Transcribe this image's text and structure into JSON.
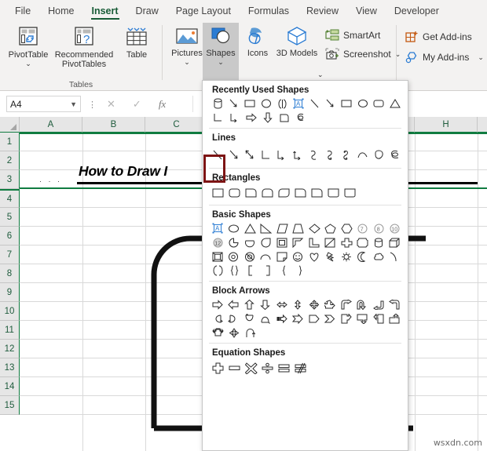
{
  "ribbon": {
    "tabs": [
      {
        "label": "File",
        "active": false
      },
      {
        "label": "Home",
        "active": false
      },
      {
        "label": "Insert",
        "active": true
      },
      {
        "label": "Draw",
        "active": false
      },
      {
        "label": "Page Layout",
        "active": false
      },
      {
        "label": "Formulas",
        "active": false
      },
      {
        "label": "Review",
        "active": false
      },
      {
        "label": "View",
        "active": false
      },
      {
        "label": "Developer",
        "active": false
      }
    ],
    "groups": [
      {
        "name": "tables",
        "label": "Tables"
      },
      {
        "name": "illustrations",
        "label": ""
      },
      {
        "name": "addins",
        "label": ""
      }
    ],
    "buttons": {
      "pivot_table": "PivotTable",
      "recommended_pivot_tables": "Recommended PivotTables",
      "table": "Table",
      "pictures": "Pictures",
      "shapes": "Shapes",
      "icons": "Icons",
      "three_d_models": "3D Models",
      "smart_art": "SmartArt",
      "screenshot": "Screenshot",
      "get_addins": "Get Add-ins",
      "my_addins": "My Add-ins"
    }
  },
  "formula_bar": {
    "name_box_value": "A4",
    "cancel_icon": "cancel-icon",
    "enter_icon": "check-icon",
    "function_icon": "fx",
    "formula_value": ""
  },
  "grid": {
    "columns": [
      "A",
      "B",
      "C",
      "H"
    ],
    "rows": [
      "1",
      "2",
      "3",
      "4",
      "5",
      "6",
      "7",
      "8",
      "9",
      "10",
      "11",
      "12",
      "13",
      "14",
      "15"
    ],
    "active_cell": "A4",
    "title_cell_text": "How to Draw I",
    "watermark": "wsxdn.com"
  },
  "shapes_menu": {
    "sections": [
      {
        "title": "Recently Used Shapes",
        "rows": [
          [
            "can-shape",
            "line-arrow-shape",
            "rectangle-shape",
            "oval-shape",
            "double-bracket-shape",
            "text-box-shape",
            "line-shape",
            "line-arrow2-shape",
            "rectangle2-shape",
            "oval2-shape",
            "rounded-rect-shape",
            "triangle-shape"
          ],
          [
            "elbow-connector-shape",
            "elbow-arrow-connector-shape",
            "right-arrow-shape",
            "down-arrow-shape",
            "flowchart-shape",
            "scribble-shape"
          ]
        ]
      },
      {
        "title": "Lines",
        "rows": [
          [
            "line-shape",
            "line-arrow-shape",
            "line-double-arrow-shape",
            "elbow-connector-shape",
            "elbow-arrow-shape",
            "elbow-double-arrow-shape",
            "curved-connector-shape",
            "curved-arrow-shape",
            "curved-double-arrow-shape",
            "curve-shape",
            "freeform-shape",
            "scribble-shape"
          ]
        ]
      },
      {
        "title": "Rectangles",
        "rows": [
          [
            "rectangle-shape",
            "rounded-rect-shape",
            "snip-single-corner-shape",
            "snip-same-side-corner-shape",
            "snip-diagonal-corner-shape",
            "snip-and-round-corner-shape",
            "round-single-corner-shape",
            "round-same-side-corner-shape",
            "round-diagonal-corner-shape"
          ]
        ]
      },
      {
        "title": "Basic Shapes",
        "rows": [
          [
            "text-box-shape",
            "oval-shape",
            "triangle-shape",
            "right-triangle-shape",
            "parallelogram-shape",
            "trapezoid-shape",
            "diamond-shape",
            "pentagon-shape",
            "hexagon-shape",
            "heptagon-shape",
            "octagon-shape",
            "decagon-shape"
          ],
          [
            "dodecagon-shape",
            "pie-shape",
            "chord-shape",
            "teardrop-shape",
            "frame-shape",
            "half-frame-shape",
            "l-shape",
            "diagonal-stripe-shape",
            "cross-shape",
            "plaque-shape",
            "cylinder-shape",
            "cube-shape"
          ],
          [
            "bevel-shape",
            "donut-shape",
            "no-symbol-shape",
            "arc-shape",
            "folded-corner-shape",
            "smiley-face-shape",
            "heart-shape",
            "lightning-bolt-shape",
            "sun-shape",
            "moon-shape",
            "cloud-shape",
            "arc2-shape"
          ],
          [
            "round-bracket-shape",
            "round-brace-shape",
            "square-bracket-left-shape",
            "square-bracket-right-shape",
            "curly-brace-left-shape",
            "curly-brace-right-shape"
          ]
        ]
      },
      {
        "title": "Block Arrows",
        "rows": [
          [
            "arrow-right-shape",
            "arrow-left-shape",
            "arrow-up-shape",
            "arrow-down-shape",
            "arrow-left-right-shape",
            "arrow-up-down-shape",
            "quad-arrow-shape",
            "left-right-up-arrow-shape",
            "bent-arrow-shape",
            "u-turn-arrow-shape",
            "left-up-arrow-shape",
            "bent-up-arrow-shape"
          ],
          [
            "curved-right-arrow-shape",
            "curved-left-arrow-shape",
            "curved-up-arrow-shape",
            "curved-down-arrow-shape",
            "striped-right-arrow-shape",
            "notched-right-arrow-shape",
            "pentagon-arrow-shape",
            "chevron-arrow-shape",
            "right-arrow-callout-shape",
            "down-arrow-callout-shape",
            "left-arrow-callout-shape",
            "up-arrow-callout-shape"
          ],
          [
            "quad-arrow-callout-shape",
            "four-point-arrow-shape",
            "circular-arrow-shape"
          ]
        ]
      },
      {
        "title": "Equation Shapes",
        "rows": [
          [
            "plus-shape",
            "minus-shape",
            "multiply-shape",
            "divide-shape",
            "equal-shape",
            "not-equal-shape"
          ]
        ]
      }
    ],
    "highlight": {
      "section": "Lines",
      "index": 0,
      "color": "#7d1414"
    }
  }
}
